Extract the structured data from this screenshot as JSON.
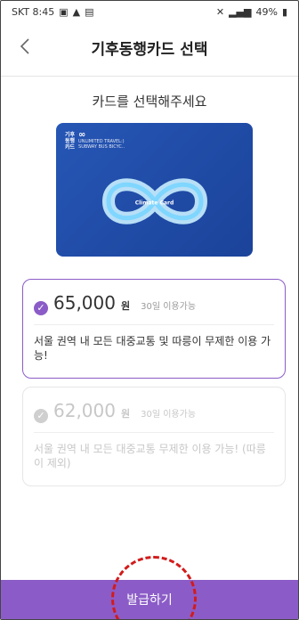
{
  "status_bar": {
    "carrier_time": "SKT 8:45",
    "battery": "49%"
  },
  "header": {
    "title": "기후동행카드 선택",
    "back_icon": "chevron-left-icon"
  },
  "subtitle": "카드를 선택해주세요",
  "card": {
    "label_line1": "기후",
    "label_line2": "동행",
    "label_line3": "카드",
    "infinity": "∞",
    "sub1": "UNLIMITED TRAVEL:)",
    "sub2": "SUBWAY BUS BICYC..",
    "center_text": "Climate Card",
    "color": "#1f4fa8"
  },
  "options": [
    {
      "price": "65,000",
      "unit": "원",
      "days": "30일 이용가능",
      "description": "서울 권역 내 모든 대중교통 및 따릉이 무제한 이용 가능!",
      "selected": true
    },
    {
      "price": "62,000",
      "unit": "원",
      "days": "30일 이용가능",
      "description": "서울 권역 내 모든 대중교통 무제한 이용 가능! (따릉이 제외)",
      "selected": false
    }
  ],
  "button": {
    "label": "발급하기"
  },
  "colors": {
    "accent": "#8b5cc7",
    "annotation": "#d21b1b"
  }
}
